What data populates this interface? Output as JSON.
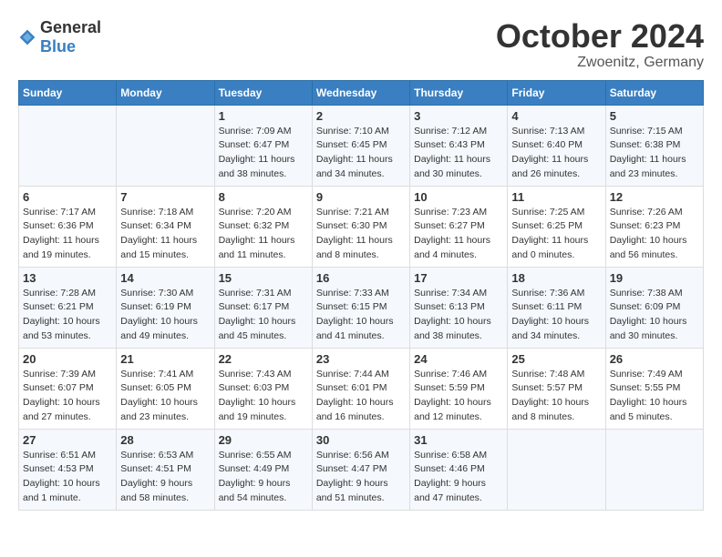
{
  "logo": {
    "text_general": "General",
    "text_blue": "Blue"
  },
  "title": {
    "month": "October 2024",
    "location": "Zwoenitz, Germany"
  },
  "weekdays": [
    "Sunday",
    "Monday",
    "Tuesday",
    "Wednesday",
    "Thursday",
    "Friday",
    "Saturday"
  ],
  "weeks": [
    [
      {
        "day": "",
        "sunrise": "",
        "sunset": "",
        "daylight": ""
      },
      {
        "day": "",
        "sunrise": "",
        "sunset": "",
        "daylight": ""
      },
      {
        "day": "1",
        "sunrise": "Sunrise: 7:09 AM",
        "sunset": "Sunset: 6:47 PM",
        "daylight": "Daylight: 11 hours and 38 minutes."
      },
      {
        "day": "2",
        "sunrise": "Sunrise: 7:10 AM",
        "sunset": "Sunset: 6:45 PM",
        "daylight": "Daylight: 11 hours and 34 minutes."
      },
      {
        "day": "3",
        "sunrise": "Sunrise: 7:12 AM",
        "sunset": "Sunset: 6:43 PM",
        "daylight": "Daylight: 11 hours and 30 minutes."
      },
      {
        "day": "4",
        "sunrise": "Sunrise: 7:13 AM",
        "sunset": "Sunset: 6:40 PM",
        "daylight": "Daylight: 11 hours and 26 minutes."
      },
      {
        "day": "5",
        "sunrise": "Sunrise: 7:15 AM",
        "sunset": "Sunset: 6:38 PM",
        "daylight": "Daylight: 11 hours and 23 minutes."
      }
    ],
    [
      {
        "day": "6",
        "sunrise": "Sunrise: 7:17 AM",
        "sunset": "Sunset: 6:36 PM",
        "daylight": "Daylight: 11 hours and 19 minutes."
      },
      {
        "day": "7",
        "sunrise": "Sunrise: 7:18 AM",
        "sunset": "Sunset: 6:34 PM",
        "daylight": "Daylight: 11 hours and 15 minutes."
      },
      {
        "day": "8",
        "sunrise": "Sunrise: 7:20 AM",
        "sunset": "Sunset: 6:32 PM",
        "daylight": "Daylight: 11 hours and 11 minutes."
      },
      {
        "day": "9",
        "sunrise": "Sunrise: 7:21 AM",
        "sunset": "Sunset: 6:30 PM",
        "daylight": "Daylight: 11 hours and 8 minutes."
      },
      {
        "day": "10",
        "sunrise": "Sunrise: 7:23 AM",
        "sunset": "Sunset: 6:27 PM",
        "daylight": "Daylight: 11 hours and 4 minutes."
      },
      {
        "day": "11",
        "sunrise": "Sunrise: 7:25 AM",
        "sunset": "Sunset: 6:25 PM",
        "daylight": "Daylight: 11 hours and 0 minutes."
      },
      {
        "day": "12",
        "sunrise": "Sunrise: 7:26 AM",
        "sunset": "Sunset: 6:23 PM",
        "daylight": "Daylight: 10 hours and 56 minutes."
      }
    ],
    [
      {
        "day": "13",
        "sunrise": "Sunrise: 7:28 AM",
        "sunset": "Sunset: 6:21 PM",
        "daylight": "Daylight: 10 hours and 53 minutes."
      },
      {
        "day": "14",
        "sunrise": "Sunrise: 7:30 AM",
        "sunset": "Sunset: 6:19 PM",
        "daylight": "Daylight: 10 hours and 49 minutes."
      },
      {
        "day": "15",
        "sunrise": "Sunrise: 7:31 AM",
        "sunset": "Sunset: 6:17 PM",
        "daylight": "Daylight: 10 hours and 45 minutes."
      },
      {
        "day": "16",
        "sunrise": "Sunrise: 7:33 AM",
        "sunset": "Sunset: 6:15 PM",
        "daylight": "Daylight: 10 hours and 41 minutes."
      },
      {
        "day": "17",
        "sunrise": "Sunrise: 7:34 AM",
        "sunset": "Sunset: 6:13 PM",
        "daylight": "Daylight: 10 hours and 38 minutes."
      },
      {
        "day": "18",
        "sunrise": "Sunrise: 7:36 AM",
        "sunset": "Sunset: 6:11 PM",
        "daylight": "Daylight: 10 hours and 34 minutes."
      },
      {
        "day": "19",
        "sunrise": "Sunrise: 7:38 AM",
        "sunset": "Sunset: 6:09 PM",
        "daylight": "Daylight: 10 hours and 30 minutes."
      }
    ],
    [
      {
        "day": "20",
        "sunrise": "Sunrise: 7:39 AM",
        "sunset": "Sunset: 6:07 PM",
        "daylight": "Daylight: 10 hours and 27 minutes."
      },
      {
        "day": "21",
        "sunrise": "Sunrise: 7:41 AM",
        "sunset": "Sunset: 6:05 PM",
        "daylight": "Daylight: 10 hours and 23 minutes."
      },
      {
        "day": "22",
        "sunrise": "Sunrise: 7:43 AM",
        "sunset": "Sunset: 6:03 PM",
        "daylight": "Daylight: 10 hours and 19 minutes."
      },
      {
        "day": "23",
        "sunrise": "Sunrise: 7:44 AM",
        "sunset": "Sunset: 6:01 PM",
        "daylight": "Daylight: 10 hours and 16 minutes."
      },
      {
        "day": "24",
        "sunrise": "Sunrise: 7:46 AM",
        "sunset": "Sunset: 5:59 PM",
        "daylight": "Daylight: 10 hours and 12 minutes."
      },
      {
        "day": "25",
        "sunrise": "Sunrise: 7:48 AM",
        "sunset": "Sunset: 5:57 PM",
        "daylight": "Daylight: 10 hours and 8 minutes."
      },
      {
        "day": "26",
        "sunrise": "Sunrise: 7:49 AM",
        "sunset": "Sunset: 5:55 PM",
        "daylight": "Daylight: 10 hours and 5 minutes."
      }
    ],
    [
      {
        "day": "27",
        "sunrise": "Sunrise: 6:51 AM",
        "sunset": "Sunset: 4:53 PM",
        "daylight": "Daylight: 10 hours and 1 minute."
      },
      {
        "day": "28",
        "sunrise": "Sunrise: 6:53 AM",
        "sunset": "Sunset: 4:51 PM",
        "daylight": "Daylight: 9 hours and 58 minutes."
      },
      {
        "day": "29",
        "sunrise": "Sunrise: 6:55 AM",
        "sunset": "Sunset: 4:49 PM",
        "daylight": "Daylight: 9 hours and 54 minutes."
      },
      {
        "day": "30",
        "sunrise": "Sunrise: 6:56 AM",
        "sunset": "Sunset: 4:47 PM",
        "daylight": "Daylight: 9 hours and 51 minutes."
      },
      {
        "day": "31",
        "sunrise": "Sunrise: 6:58 AM",
        "sunset": "Sunset: 4:46 PM",
        "daylight": "Daylight: 9 hours and 47 minutes."
      },
      {
        "day": "",
        "sunrise": "",
        "sunset": "",
        "daylight": ""
      },
      {
        "day": "",
        "sunrise": "",
        "sunset": "",
        "daylight": ""
      }
    ]
  ]
}
